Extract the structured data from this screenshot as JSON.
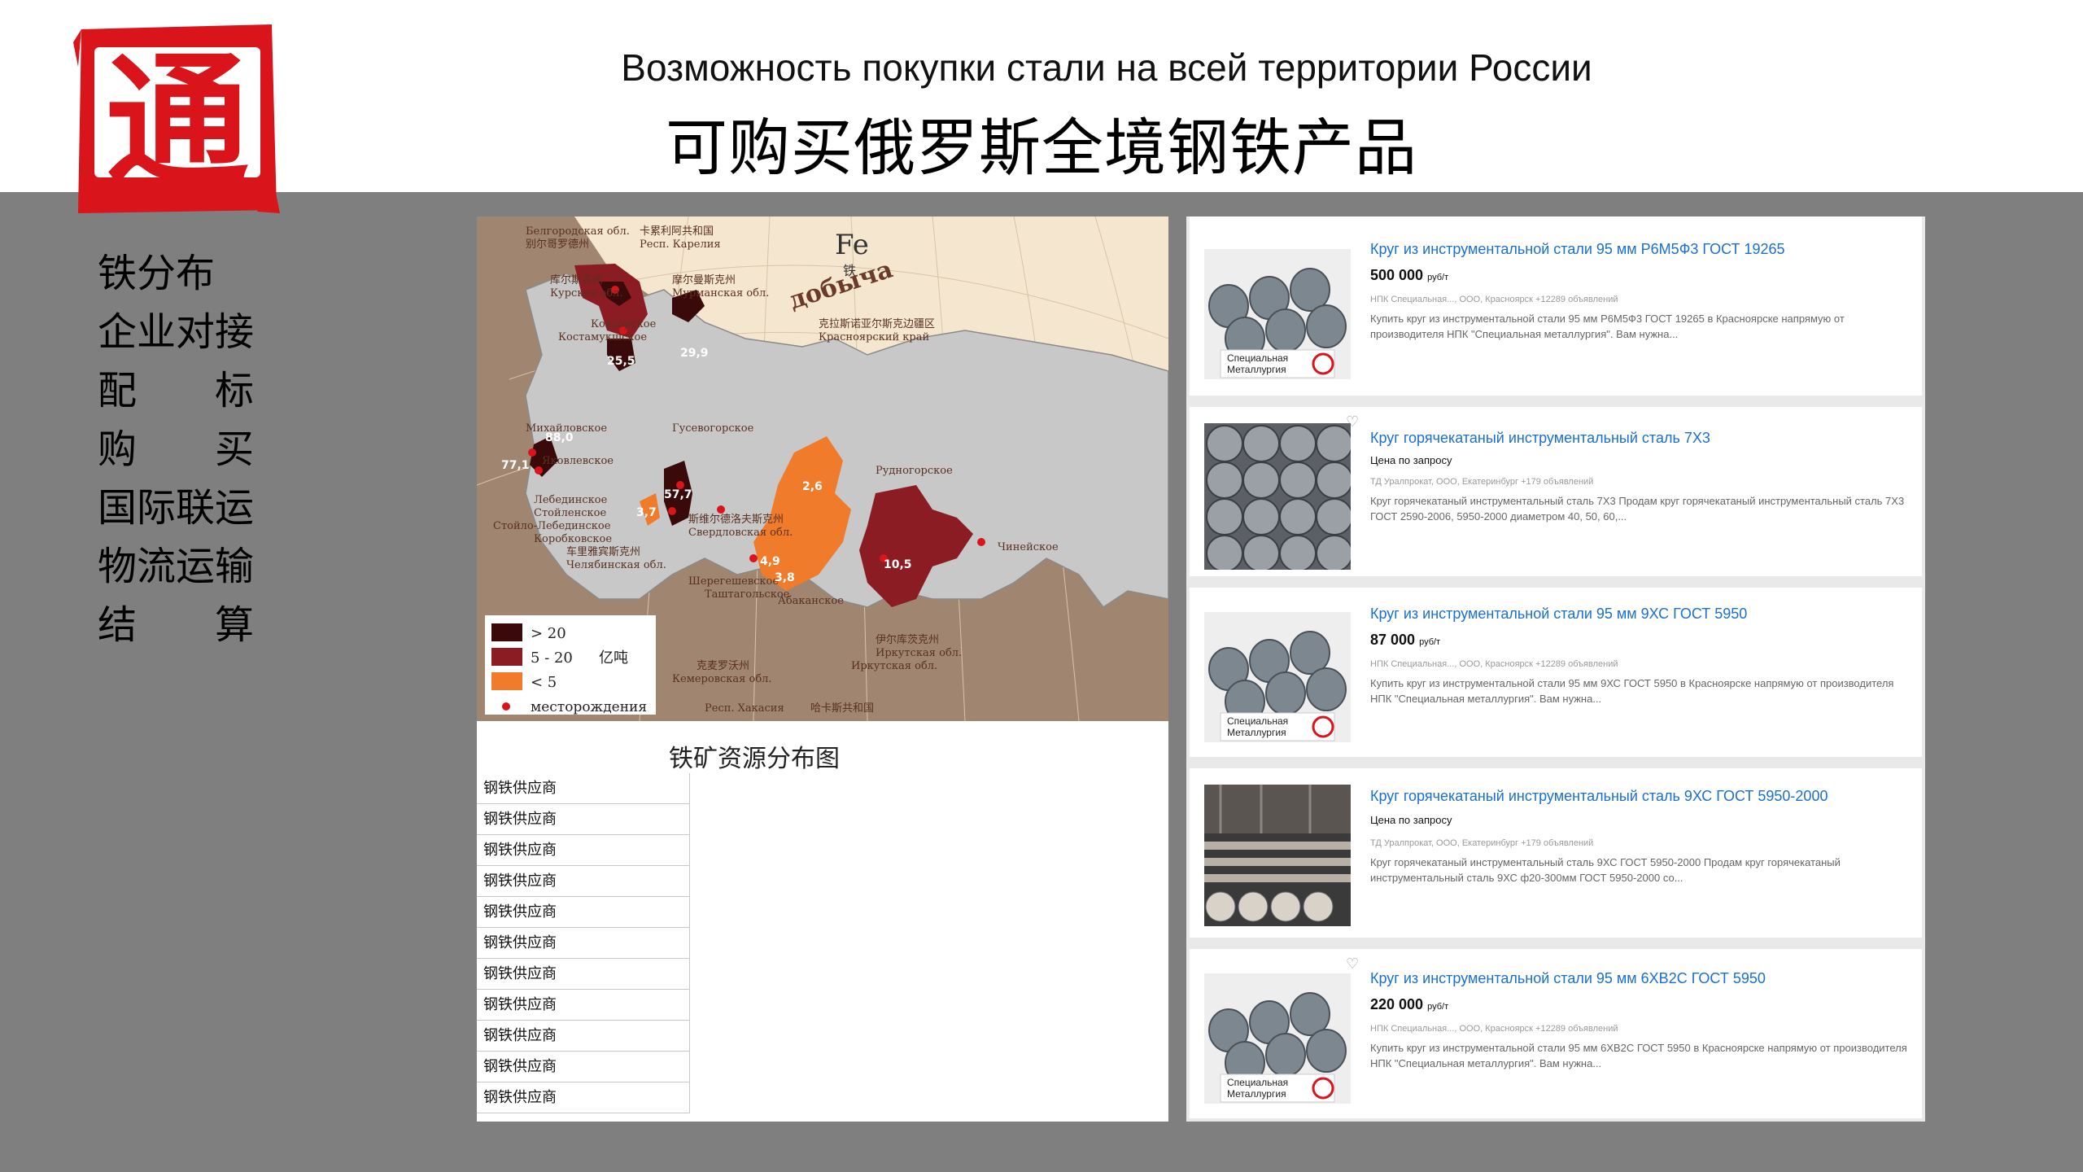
{
  "header": {
    "title_ru": "Возможность покупки стали на всей территории России",
    "title_zh": "可购买俄罗斯全境钢铁产品",
    "logo_char": "通"
  },
  "menu": {
    "items": [
      "铁分布",
      "企业对接",
      "配　　标",
      "购　　买",
      "国际联运",
      "物流运输",
      "结　　算"
    ]
  },
  "map": {
    "fe_label": "Fe",
    "fe_zh": "铁",
    "dobycha": "добыча",
    "regions": {
      "belgorod": "Белгородская обл.",
      "belgorod_zh": "别尔哥罗德州",
      "karelia": "Респ. Карелия",
      "karelia_zh": "卡累利阿共和国",
      "kursk": "Курская обл.",
      "kursk_zh": "库尔斯克州",
      "murmansk": "Мурманская обл.",
      "murmansk_zh": "摩尔曼斯克州",
      "krasnoyarsk": "Красноярский край",
      "krasnoyarsk_zh": "克拉斯诺亚尔斯克边疆区",
      "kovdorskoe": "Ковдорское",
      "kostamukshskoe": "Костамукшское",
      "mikhaylovskoe": "Михайловское",
      "yakovlevskoe": "Яковлевское",
      "gusevogorskoe": "Гусевогорское",
      "rudnogorskoe": "Рудногорское",
      "lebedinskoe": "Лебединское",
      "stoylenskoe": "Стойленское",
      "stoylo": "Стойло-Лебединское",
      "korobkovskoe": "Коробковское",
      "chelyabinsk": "Челябинская обл.",
      "chelyabinsk_zh": "车里雅宾斯克州",
      "sverdlovsk": "Свердловская обл.",
      "sverdlovsk_zh": "斯维尔德洛夫斯克州",
      "sheregesh": "Шерегешевское",
      "tashtagol": "Таштагольское",
      "abakan": "Абаканское",
      "chineyskoe": "Чинейское",
      "irkutsk": "Иркутская обл.",
      "irkutsk_zh": "伊尔库茨克州",
      "kemerovo": "Кемеровская обл.",
      "kemerovo_zh": "克麦罗沃州",
      "khakassia": "Респ. Хакасия",
      "khakassia_zh": "哈卡斯共和国"
    },
    "values": [
      "25,5",
      "29,9",
      "88,0",
      "77,1",
      "57,7",
      "3,7",
      "2,6",
      "4,9",
      "3,8",
      "10,5"
    ],
    "legend": {
      "items": [
        "> 20",
        "5 - 20",
        "< 5"
      ],
      "unit": "亿吨",
      "deposits": "месторождения",
      "colors": [
        "#3a0a0a",
        "#8c1c24",
        "#f07b2a"
      ]
    },
    "caption": "铁矿资源分布图"
  },
  "suppliers": [
    "钢铁供应商",
    "钢铁供应商",
    "钢铁供应商",
    "钢铁供应商",
    "钢铁供应商",
    "钢铁供应商",
    "钢铁供应商",
    "钢铁供应商",
    "钢铁供应商",
    "钢铁供应商",
    "钢铁供应商"
  ],
  "listings": [
    {
      "title": "Круг из инструментальной стали 95 мм Р6М5Ф3 ГОСТ 19265",
      "price": "500 000",
      "unit": "руб/т",
      "seller": "НПК Специальная..., ООО, Красноярск   +12289 объявлений",
      "desc": "Купить круг из инструментальной стали 95 мм Р6М5Ф3 ГОСТ 19265 в Красноярске напрямую от производителя НПК \"Специальная металлургия\". Вам нужна...",
      "brand": "Специальная Металлургия"
    },
    {
      "title": "Круг горячекатаный инструментальный сталь 7Х3",
      "price": "Цена по запросу",
      "unit": "",
      "seller": "ТД Уралпрокат, ООО, Екатеринбург   +179 объявлений",
      "desc": "Круг горячекатаный инструментальный сталь 7Х3 Продам круг горячекатаный инструментальный сталь 7Х3 ГОСТ 2590-2006, 5950-2000 диаметром 40, 50, 60,...",
      "brand": ""
    },
    {
      "title": "Круг из инструментальной стали 95 мм 9ХС ГОСТ 5950",
      "price": "87 000",
      "unit": "руб/т",
      "seller": "НПК Специальная..., ООО, Красноярск   +12289 объявлений",
      "desc": "Купить круг из инструментальной стали 95 мм 9ХС ГОСТ 5950 в Красноярске напрямую от производителя НПК \"Специальная металлургия\". Вам нужна...",
      "brand": "Специальная Металлургия"
    },
    {
      "title": "Круг горячекатаный инструментальный сталь 9ХС ГОСТ 5950-2000",
      "price": "Цена по запросу",
      "unit": "",
      "seller": "ТД Уралпрокат, ООО, Екатеринбург   +179 объявлений",
      "desc": "Круг горячекатаный инструментальный сталь 9ХС ГОСТ 5950-2000 Продам круг горячекатаный инструментальный сталь 9ХС ф20-300мм ГОСТ 5950-2000 со...",
      "brand": ""
    },
    {
      "title": "Круг из инструментальной стали 95 мм 6ХВ2С ГОСТ 5950",
      "price": "220 000",
      "unit": "руб/т",
      "seller": "НПК Специальная..., ООО, Красноярск   +12289 объявлений",
      "desc": "Купить круг из инструментальной стали 95 мм 6ХВ2С ГОСТ 5950 в Красноярске напрямую от производителя НПК \"Специальная металлургия\". Вам нужна...",
      "brand": "Специальная Металлургия"
    }
  ],
  "colors": {
    "seal_red": "#d9141b",
    "map_land": "#a08670",
    "map_sea": "#f4e6cf",
    "russia_fill": "#c8c8c8",
    "link_blue": "#1a6fd0"
  }
}
